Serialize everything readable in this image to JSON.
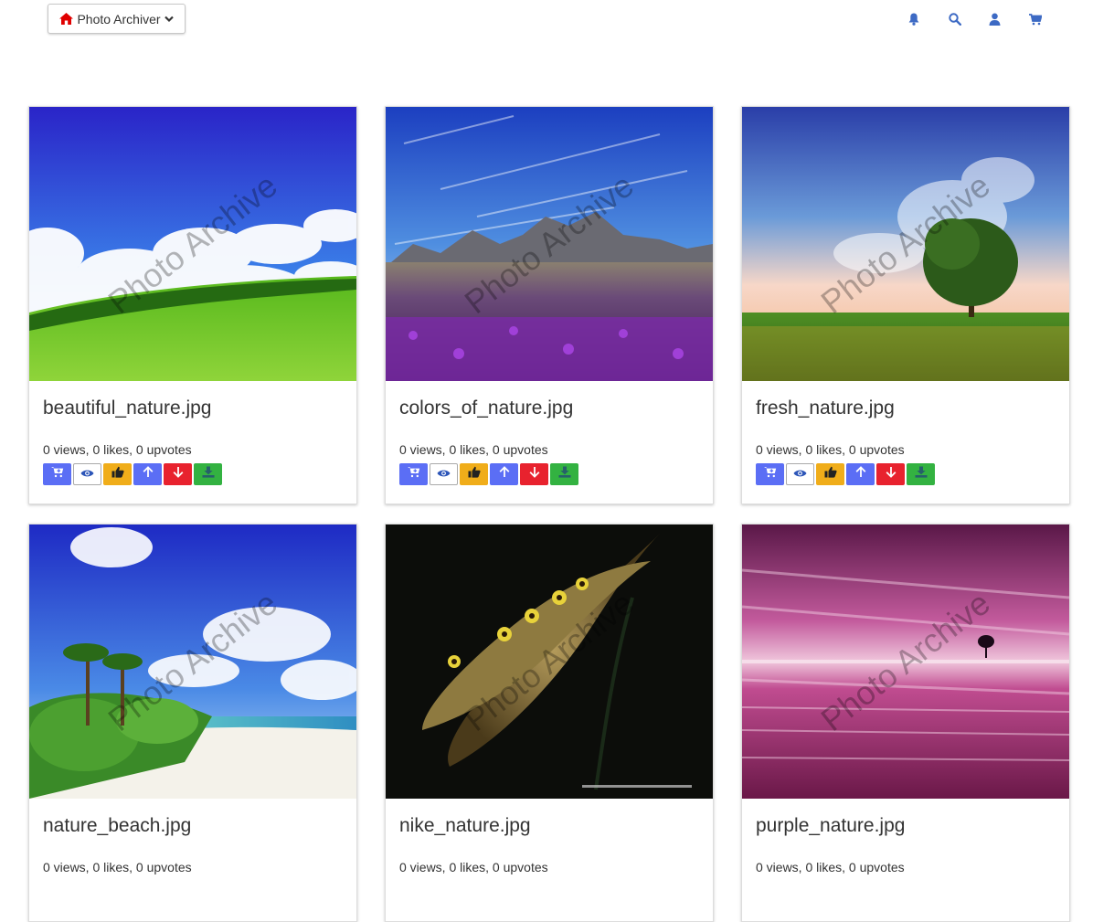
{
  "navbar": {
    "brand_label": "Photo Archiver",
    "icons": [
      "bell-icon",
      "search-icon",
      "user-icon",
      "cart-icon"
    ],
    "accent": "#3d6ac4"
  },
  "watermark_text": "Photo Archive",
  "action_buttons": [
    {
      "icon": "cart-plus-icon",
      "color": "#5b6ef5"
    },
    {
      "icon": "eye-icon",
      "color": "#ffffff"
    },
    {
      "icon": "thumbs-up-icon",
      "color": "#f0ad1a"
    },
    {
      "icon": "arrow-up-icon",
      "color": "#5b6ef5"
    },
    {
      "icon": "arrow-down-icon",
      "color": "#e8222e"
    },
    {
      "icon": "download-icon",
      "color": "#33b241"
    }
  ],
  "photos": [
    {
      "title": "beautiful_nature.jpg",
      "stats": "0 views, 0 likes, 0 upvotes"
    },
    {
      "title": "colors_of_nature.jpg",
      "stats": "0 views, 0 likes, 0 upvotes"
    },
    {
      "title": "fresh_nature.jpg",
      "stats": "0 views, 0 likes, 0 upvotes"
    },
    {
      "title": "nature_beach.jpg",
      "stats": "0 views, 0 likes, 0 upvotes"
    },
    {
      "title": "nike_nature.jpg",
      "stats": "0 views, 0 likes, 0 upvotes"
    },
    {
      "title": "purple_nature.jpg",
      "stats": "0 views, 0 likes, 0 upvotes"
    }
  ]
}
